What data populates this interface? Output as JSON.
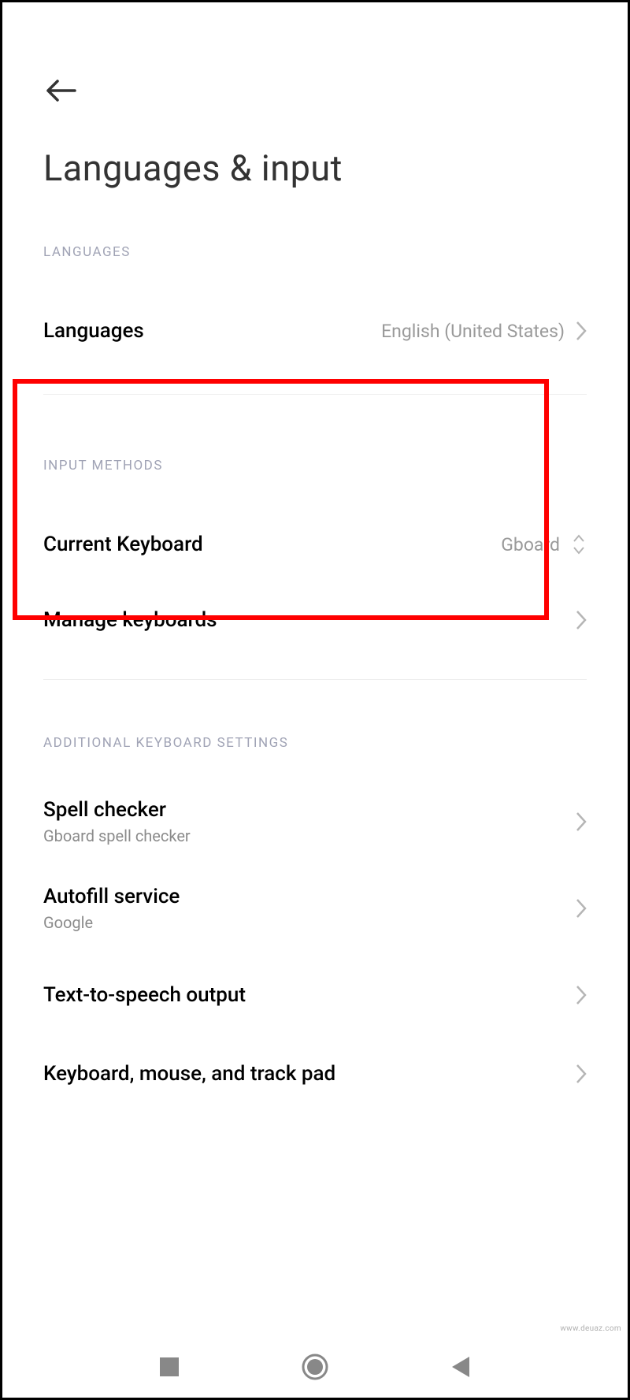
{
  "page": {
    "title": "Languages & input"
  },
  "sections": {
    "languages": {
      "header": "LANGUAGES",
      "items": {
        "languages": {
          "title": "Languages",
          "value": "English (United States)"
        }
      }
    },
    "input_methods": {
      "header": "INPUT METHODS",
      "items": {
        "current_keyboard": {
          "title": "Current Keyboard",
          "value": "Gboard"
        },
        "manage_keyboards": {
          "title": "Manage keyboards"
        }
      }
    },
    "additional": {
      "header": "ADDITIONAL KEYBOARD SETTINGS",
      "items": {
        "spell_checker": {
          "title": "Spell checker",
          "subtitle": "Gboard spell checker"
        },
        "autofill": {
          "title": "Autofill service",
          "subtitle": "Google"
        },
        "tts": {
          "title": "Text-to-speech output"
        },
        "kmt": {
          "title": "Keyboard, mouse, and track pad"
        }
      }
    }
  },
  "watermark": "www.deuaz.com"
}
